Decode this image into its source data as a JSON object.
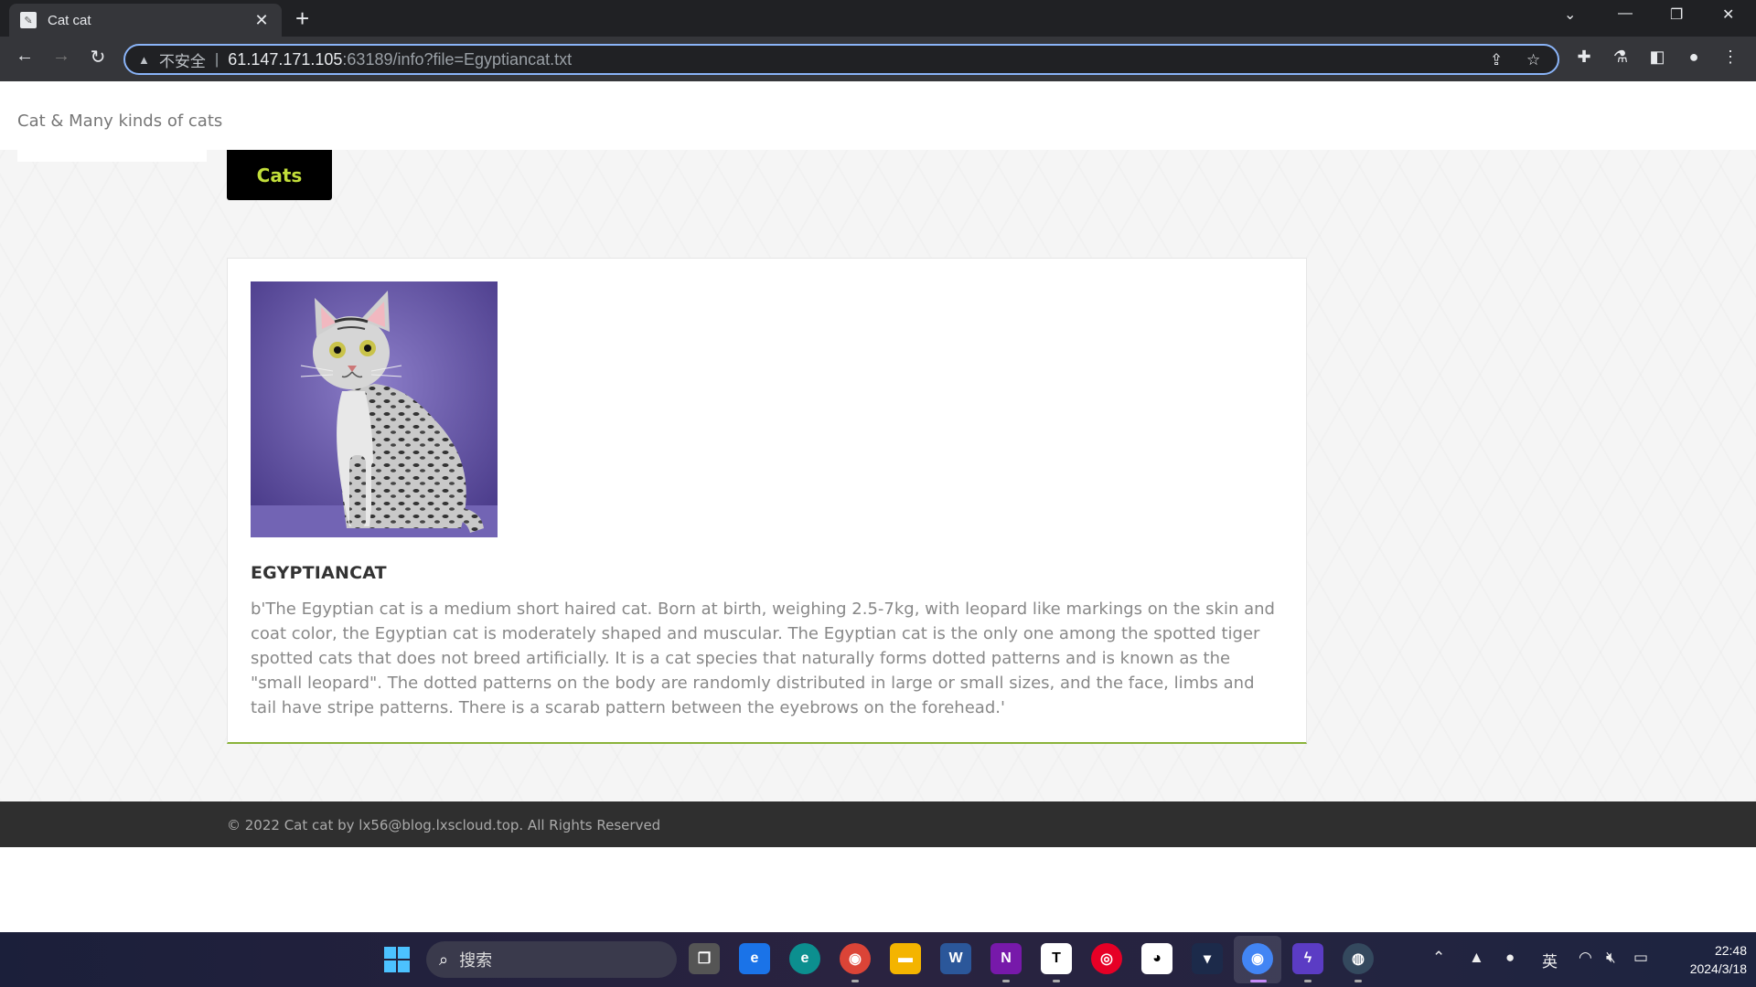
{
  "browser": {
    "tab_title": "Cat cat",
    "new_tab": "+",
    "security_label": "不安全",
    "url_host": "61.147.171.105",
    "url_rest": ":63189/info?file=Egyptiancat.txt"
  },
  "site": {
    "brand": "Cat & Many kinds of cats",
    "nav_button": "Cats"
  },
  "article": {
    "title": "EGYPTIANCAT",
    "description": "b'The Egyptian cat is a medium short haired cat. Born at birth, weighing 2.5-7kg, with leopard like markings on the skin and coat color, the Egyptian cat is moderately shaped and muscular. The Egyptian cat is the only one among the spotted tiger spotted cats that does not breed artificially. It is a cat species that naturally forms dotted patterns and is known as the \"small leopard\". The dotted patterns on the body are randomly distributed in large or small sizes, and the face, limbs and tail have stripe patterns. There is a scarab pattern between the eyebrows on the forehead.'"
  },
  "footer": {
    "text": "© 2022 Cat cat by lx56@blog.lxscloud.top. All Rights Reserved"
  },
  "taskbar": {
    "search_text": "搜索",
    "ime": "英",
    "time": "22:48",
    "date": "2024/3/18"
  },
  "colors": {
    "accent_green": "#c2de3a",
    "card_border": "#8ab33a",
    "footer_bg": "#2f2f2f",
    "chrome_dark": "#202124"
  }
}
